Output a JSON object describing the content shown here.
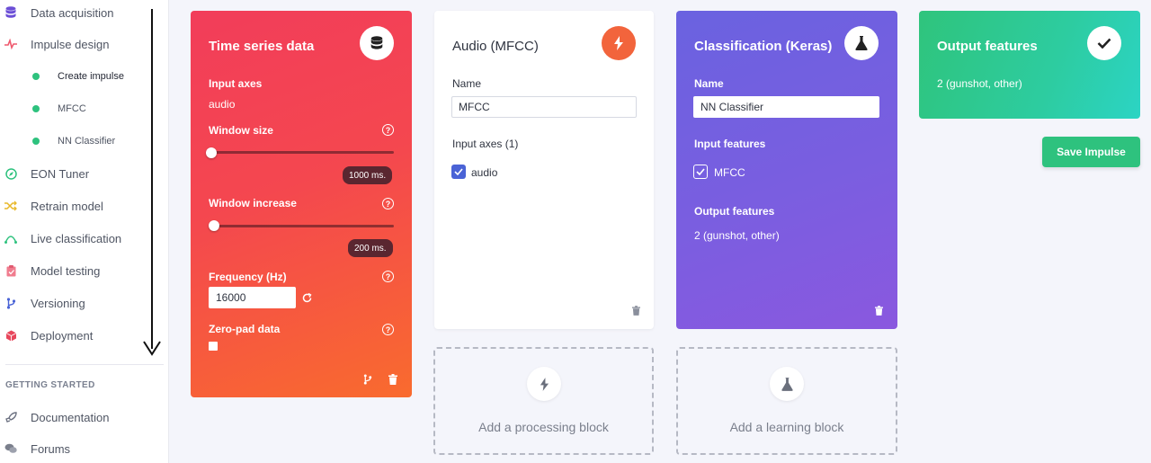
{
  "sidebar": {
    "items": [
      {
        "label": "Data acquisition",
        "icon": "database-icon"
      },
      {
        "label": "Impulse design",
        "icon": "pulse-icon"
      },
      {
        "label": "EON Tuner",
        "icon": "compass-icon"
      },
      {
        "label": "Retrain model",
        "icon": "shuffle-icon"
      },
      {
        "label": "Live classification",
        "icon": "signal-icon"
      },
      {
        "label": "Model testing",
        "icon": "clipboard-icon"
      },
      {
        "label": "Versioning",
        "icon": "branch-icon"
      },
      {
        "label": "Deployment",
        "icon": "cube-icon"
      }
    ],
    "subitems": [
      {
        "label": "Create impulse"
      },
      {
        "label": "MFCC"
      },
      {
        "label": "NN Classifier"
      }
    ],
    "section_title": "GETTING STARTED",
    "getting_started": [
      {
        "label": "Documentation",
        "icon": "rocket-icon"
      },
      {
        "label": "Forums",
        "icon": "chat-icon"
      }
    ]
  },
  "timeseries": {
    "title": "Time series data",
    "input_axes_label": "Input axes",
    "input_axes_value": "audio",
    "window_size_label": "Window size",
    "window_size_value": "1000 ms.",
    "window_increase_label": "Window increase",
    "window_increase_value": "200 ms.",
    "frequency_label": "Frequency (Hz)",
    "frequency_value": "16000",
    "zero_pad_label": "Zero-pad data",
    "help_glyph": "?"
  },
  "audio": {
    "title": "Audio (MFCC)",
    "name_label": "Name",
    "name_value": "MFCC",
    "input_axes_label": "Input axes (1)",
    "axis_option": "audio"
  },
  "classification": {
    "title": "Classification (Keras)",
    "name_label": "Name",
    "name_value": "NN Classifier",
    "input_features_label": "Input features",
    "feature_option": "MFCC",
    "output_features_label": "Output features",
    "output_features_value": "2 (gunshot, other)"
  },
  "output": {
    "title": "Output features",
    "value": "2 (gunshot, other)"
  },
  "add_processing_label": "Add a processing block",
  "add_learning_label": "Add a learning block",
  "save_button_label": "Save Impulse",
  "colors": {
    "timeseries_gradient": [
      "#f23d5a",
      "#f96b2e"
    ],
    "audio_icon": "#f2643c",
    "classification_gradient": [
      "#6a62e0",
      "#8a58df"
    ],
    "output_gradient": [
      "#2fc47c",
      "#2cd4c4"
    ],
    "save_button": "#2ec27e"
  }
}
